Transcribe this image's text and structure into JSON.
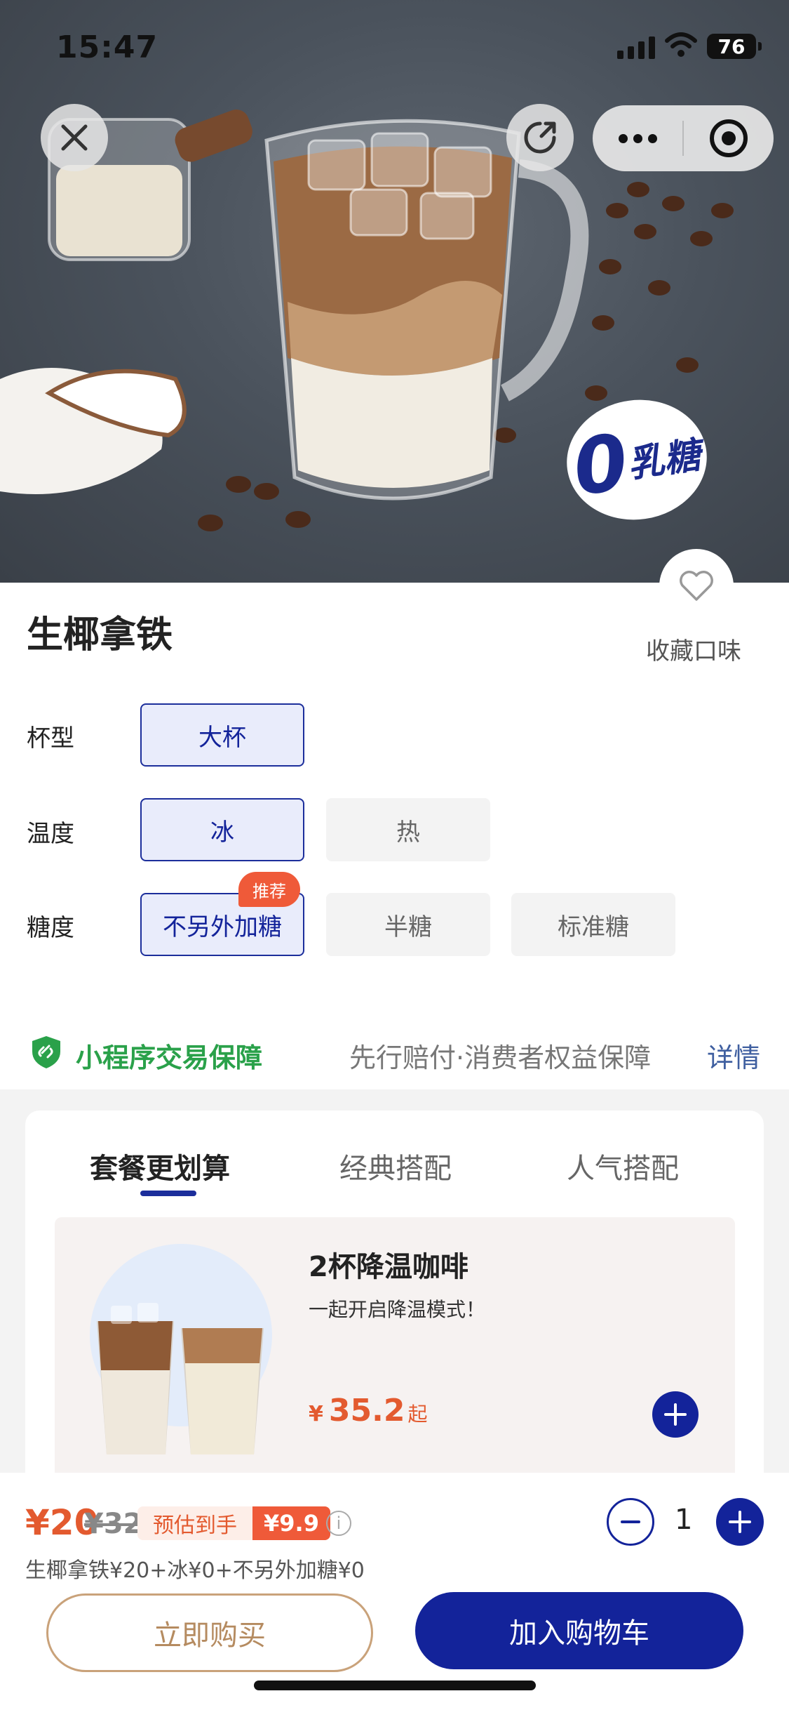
{
  "status_bar": {
    "time": "15:47",
    "battery": "76"
  },
  "hero": {
    "badge_letter": "0",
    "badge_text": "乳糖"
  },
  "favorite": {
    "label": "收藏口味"
  },
  "product": {
    "name": "生椰拿铁"
  },
  "options": {
    "cup": {
      "label": "杯型",
      "choices": [
        "大杯"
      ],
      "selected": "大杯"
    },
    "temperature": {
      "label": "温度",
      "choices": [
        "冰",
        "热"
      ],
      "selected": "冰"
    },
    "sugar": {
      "label": "糖度",
      "choices": [
        "不另外加糖",
        "半糖",
        "标准糖"
      ],
      "selected": "不另外加糖",
      "recommend_tag": "推荐"
    }
  },
  "guarantee": {
    "title": "小程序交易保障",
    "description": "先行赔付·消费者权益保障",
    "link": "详情"
  },
  "combos": {
    "tabs": [
      "套餐更划算",
      "经典搭配",
      "人气搭配"
    ],
    "active_tab": "套餐更划算",
    "item": {
      "title": "2杯降温咖啡",
      "subtitle": "一起开启降温模式！",
      "currency": "¥",
      "price": "35.2",
      "price_suffix": "起"
    }
  },
  "bottom": {
    "price_now": "¥20",
    "price_old": "¥32",
    "estimate_label": "预估到手",
    "estimate_price": "¥9.9",
    "info_symbol": "i",
    "quantity": "1",
    "summary": "生椰拿铁¥20+冰¥0+不另外加糖¥0",
    "buy_now": "立即购买",
    "add_to_cart": "加入购物车"
  },
  "colors": {
    "brand_blue": "#13239a",
    "accent_orange": "#e35a2f",
    "guarantee_green": "#2aa14a",
    "buy_now_gold": "#b58b60"
  },
  "icons": [
    "close-icon",
    "share-icon",
    "more-icon",
    "target-icon",
    "heart-icon",
    "shield-icon",
    "info-icon",
    "minus-icon",
    "plus-icon"
  ]
}
